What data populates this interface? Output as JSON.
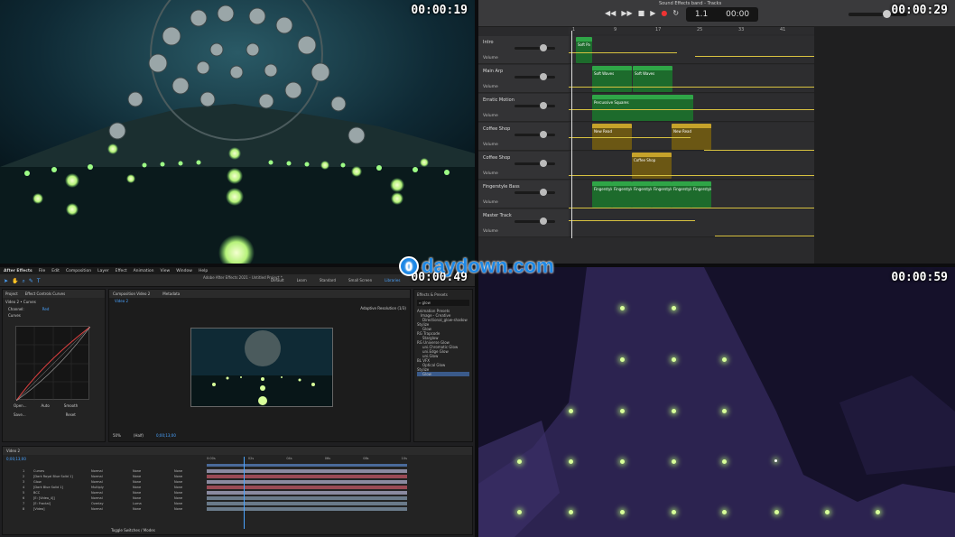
{
  "timestamps": {
    "top_left": "00:00:19",
    "top_right": "00:00:29",
    "bottom_left": "00:00:49",
    "bottom_right": "00:00:59"
  },
  "watermark": {
    "circle": "0",
    "text": "daydown.com"
  },
  "daw": {
    "window_title": "Sound Effects band - Tracks",
    "lcd_bar": "1.1",
    "lcd_time": "00:00",
    "ruler_marks": [
      "1",
      "9",
      "17",
      "25",
      "33",
      "41",
      "49",
      "57",
      "65"
    ],
    "tracks": [
      {
        "name": "Intro",
        "volume_label": "Volume"
      },
      {
        "name": "Main Arp",
        "volume_label": "Volume"
      },
      {
        "name": "Erratic Motion",
        "volume_label": "Volume"
      },
      {
        "name": "Coffee Shop",
        "volume_label": "Volume"
      },
      {
        "name": "Coffee Shop",
        "volume_label": "Volume"
      },
      {
        "name": "Fingerstyle Bass",
        "volume_label": "Volume"
      },
      {
        "name": "Master Track",
        "volume_label": "Volume"
      }
    ],
    "regions": {
      "intro": "Soft Pa",
      "main_arp_1": "Soft Waves",
      "main_arp_2": "Soft Waves",
      "erratic": "Percussive Squares",
      "coffee1_a": "New Read",
      "coffee1_b": "New Read",
      "coffee2": "Coffee Shop",
      "bass": [
        "Fingerstyle",
        "Fingerstyle",
        "Fingerstyle",
        "Fingerstyle",
        "Fingerstyle",
        "Fingerstyle"
      ]
    },
    "colors": {
      "green": "#2fa547",
      "yellow": "#c6a22a",
      "automation": "#d8c240"
    }
  },
  "ae": {
    "menu": [
      "After Effects",
      "File",
      "Edit",
      "Composition",
      "Layer",
      "Effect",
      "Animation",
      "View",
      "Window",
      "Help"
    ],
    "app_title": "Adobe After Effects 2021 - Untitled Project *",
    "workspaces": [
      "Default",
      "Learn",
      "Standard",
      "Small Screen",
      "Libraries"
    ],
    "left_tabs": [
      "Project",
      "Effect Controls Curves"
    ],
    "left_layer": "Video 2 • Curves",
    "channel_label": "Channel:",
    "channel_value": "Red",
    "curves_label": "Curves",
    "curve_buttons": [
      "Open...",
      "Auto",
      "Smooth",
      "Save...",
      "Reset"
    ],
    "comp_tab": "Composition Video 2",
    "metadata_tab": "Metadata",
    "comp_sub": "Video 2",
    "adaptive": "Adaptive Resolution (1/3)",
    "zoom": "50%",
    "quality": "(Half)",
    "timecode_readout": "0;00;13;00",
    "right_panel_title": "Effects & Presets",
    "search": "glow",
    "effects_list": [
      "Animation Presets",
      "Image - Creative",
      "Directional_glow-shadow",
      "Stylize",
      "Glow",
      "RG Trapcode",
      "Starglow",
      "RG Universe Glow",
      "uni.Chromatic Glow",
      "uni.Edge Glow",
      "uni.Glow",
      "BL VFX",
      "Optical Glow",
      "Stylize",
      "Glow"
    ],
    "timeline_tab": "Video 2",
    "timeline_time": "0;00;13;00",
    "timeline_marks": [
      "0:00s",
      "02s",
      "04s",
      "06s",
      "08s",
      "10s"
    ],
    "layers": [
      {
        "num": "1",
        "name": "Curves",
        "mode": "Normal",
        "trkmat": "None",
        "parent": "None"
      },
      {
        "num": "2",
        "name": "[Dark Royal Blue Solid 1]",
        "mode": "Normal",
        "trkmat": "None",
        "parent": "None"
      },
      {
        "num": "3",
        "name": "Glow",
        "mode": "Normal",
        "trkmat": "None",
        "parent": "None"
      },
      {
        "num": "4",
        "name": "[Dark Blue Solid 1]",
        "mode": "Multiply",
        "trkmat": "None",
        "parent": "None"
      },
      {
        "num": "5",
        "name": "BCC",
        "mode": "Normal",
        "trkmat": "None",
        "parent": "None"
      },
      {
        "num": "6",
        "name": "[E: [Video_4]]",
        "mode": "Normal",
        "trkmat": "None",
        "parent": "None"
      },
      {
        "num": "7",
        "name": "[E: Fractal]",
        "mode": "Overlay",
        "trkmat": "Luma",
        "parent": "None"
      },
      {
        "num": "8",
        "name": "[Video]",
        "mode": "Normal",
        "trkmat": "None",
        "parent": "None"
      }
    ],
    "toggle_label": "Toggle Switches / Modes"
  }
}
